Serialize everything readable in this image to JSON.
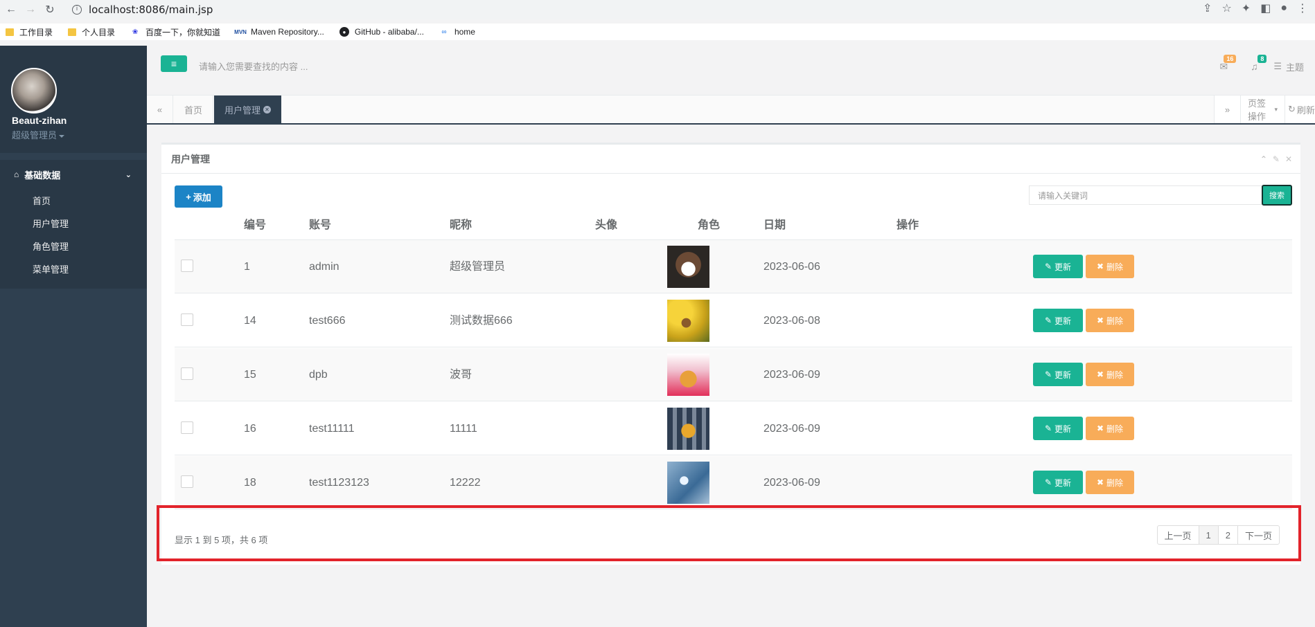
{
  "browser": {
    "url": "localhost:8086/main.jsp",
    "bookmarks": [
      "工作目录",
      "个人目录",
      "百度一下，你就知道",
      "Maven Repository...",
      "GitHub - alibaba/...",
      "home"
    ]
  },
  "sidebar": {
    "user_name": "Beaut-zihan",
    "user_role": "超级管理员",
    "group_label": "基础数据",
    "items": [
      {
        "label": "首页"
      },
      {
        "label": "用户管理"
      },
      {
        "label": "角色管理"
      },
      {
        "label": "菜单管理"
      }
    ]
  },
  "header": {
    "search_placeholder": "请输入您需要查找的内容 ...",
    "mail_count": "16",
    "bell_count": "8",
    "theme_label": "主题",
    "colors": {
      "mail_badge": "#f8ac59",
      "bell_badge": "#1ab394"
    }
  },
  "tabs": {
    "home_label": "首页",
    "active_label": "用户管理",
    "page_ops_label": "页签操作",
    "refresh_label": "刷新"
  },
  "panel": {
    "title": "用户管理",
    "add_label": "添加",
    "keyword_placeholder": "请输入关键词",
    "search_label": "搜索"
  },
  "table": {
    "columns": [
      "编号",
      "账号",
      "昵称",
      "头像",
      "角色",
      "日期",
      "操作"
    ],
    "update_label": "更新",
    "delete_label": "删除",
    "rows": [
      {
        "id": "1",
        "account": "admin",
        "nickname": "超级管理员",
        "role": "",
        "date": "2023-06-06",
        "avatar": "masked-person-photo"
      },
      {
        "id": "14",
        "account": "test666",
        "nickname": "测试数据666",
        "role": "",
        "date": "2023-06-08",
        "avatar": "yellow-flowers-dog-photo"
      },
      {
        "id": "15",
        "account": "dpb",
        "nickname": "波哥",
        "role": "",
        "date": "2023-06-09",
        "avatar": "noodle-package-photo"
      },
      {
        "id": "16",
        "account": "test11111",
        "nickname": "11111",
        "role": "",
        "date": "2023-06-09",
        "avatar": "store-shelf-photo"
      },
      {
        "id": "18",
        "account": "test1123123",
        "nickname": "12222",
        "role": "",
        "date": "2023-06-09",
        "avatar": "blue-object-photo"
      }
    ]
  },
  "pagination": {
    "summary": "显示 1 到 5 项，共 6 项",
    "prev_label": "上一页",
    "pages": [
      "1",
      "2"
    ],
    "next_label": "下一页",
    "current_page": "1"
  },
  "annotation": {
    "highlight_color": "#e2232b"
  }
}
